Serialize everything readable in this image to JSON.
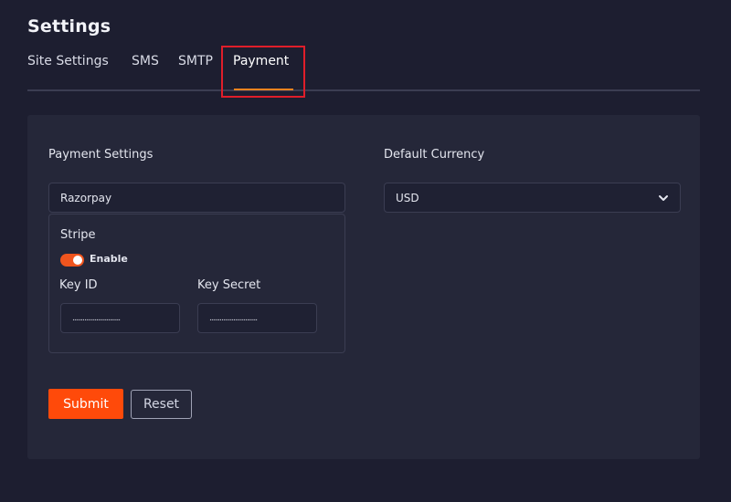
{
  "page": {
    "title": "Settings"
  },
  "tabs": [
    {
      "label": "Site Settings"
    },
    {
      "label": "SMS"
    },
    {
      "label": "SMTP"
    },
    {
      "label": "Payment",
      "active": true
    }
  ],
  "colors": {
    "accent": "#f5831f",
    "toggle_on": "#f0551e",
    "submit_bg": "#ff4a0a",
    "highlight": "#e01e2a"
  },
  "payment": {
    "section_label": "Payment Settings",
    "provider_value": "Razorpay",
    "stripe": {
      "title": "Stripe",
      "enable_label": "Enable",
      "enabled": true,
      "key_id_label": "Key ID",
      "key_id_value": "............................",
      "key_secret_label": "Key Secret",
      "key_secret_value": "............................"
    }
  },
  "currency": {
    "label": "Default Currency",
    "selected": "USD",
    "icon": "chevron-down-icon"
  },
  "actions": {
    "submit_label": "Submit",
    "reset_label": "Reset"
  }
}
